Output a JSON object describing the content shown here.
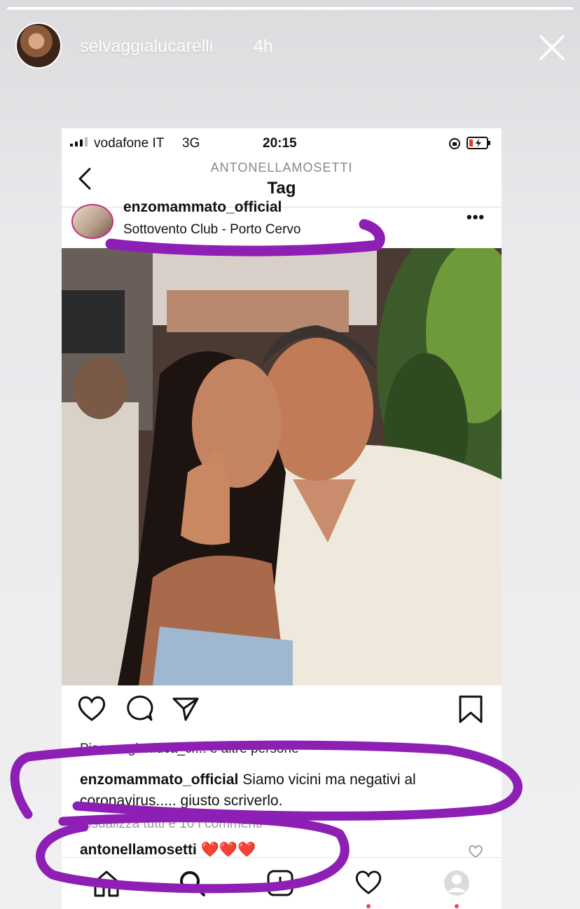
{
  "story": {
    "username": "selvaggialucarelli",
    "time": "4h",
    "progress": 1.0
  },
  "status_bar": {
    "carrier": "vodafone IT",
    "network": "3G",
    "time": "20:15"
  },
  "nav": {
    "subtitle": "ANTONELLAMOSETTI",
    "title": "Tag"
  },
  "post": {
    "username": "enzomammato_official",
    "location": "Sottovento Club - Porto Cervo",
    "more": "•••",
    "likes_text": "Piace a gianluca_cr... e altre persone",
    "caption_user": "enzomammato_official",
    "caption_text": "Siamo vicini ma negativi al coronavirus..... giusto scriverlo.",
    "view_comments": "Visualizza tutti e 10 i commenti",
    "comment_user": "antonellamosetti",
    "comment_text": "❤️❤️❤️"
  },
  "colors": {
    "annotation": "#8e1fb5",
    "notification_dot": "#ed4956"
  },
  "icons": [
    "close-icon",
    "back-icon",
    "heart-icon",
    "comment-icon",
    "share-icon",
    "bookmark-icon",
    "home-icon",
    "search-icon",
    "add-icon",
    "activity-icon",
    "profile-icon"
  ]
}
